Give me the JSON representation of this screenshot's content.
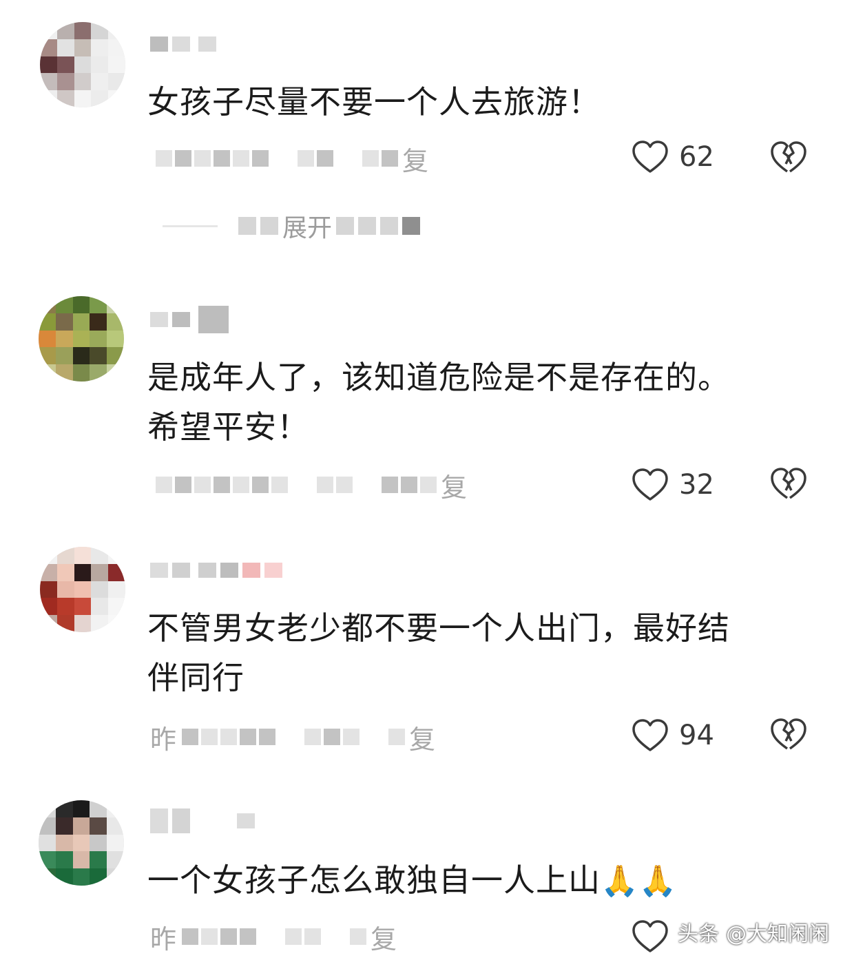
{
  "comments": [
    {
      "username": "",
      "text": "女孩子尽量不要一个人去旅游！",
      "time_label": "",
      "reply_label": "复",
      "likes": "62",
      "expand_label": "展开"
    },
    {
      "username": "",
      "text_line1": "是成年人了，该知道危险是不是存在的。",
      "text_line2": "希望平安！",
      "time_label": "",
      "reply_label": "复",
      "likes": "32"
    },
    {
      "username": "",
      "text_line1": "不管男女老少都不要一个人出门，最好结",
      "text_line2": "伴同行",
      "time_label": "昨",
      "reply_label": "复",
      "likes": "94"
    },
    {
      "username": "",
      "text": "一个女孩子怎么敢独自一人上山",
      "emoji": "🙏🙏",
      "time_label": "昨",
      "reply_label": "复"
    }
  ],
  "icons": {
    "like": "heart-outline-icon",
    "dislike": "broken-heart-icon"
  },
  "watermark": {
    "brand": "头条",
    "account": "@大知闲闲"
  }
}
